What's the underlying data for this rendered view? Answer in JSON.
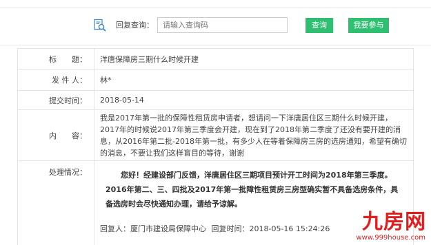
{
  "search": {
    "label": "回复查询：",
    "placeholder": "请输入查询码",
    "query_button": "查询",
    "join_button": "我要参与"
  },
  "detail": {
    "title_label": "标　　题：",
    "title_value": "洋唐保障房三期什么时候开建",
    "sender_label": "发 件 人：",
    "sender_value": "林*",
    "time_label": "提交时间：",
    "time_value": "2018-05-14",
    "content_label": "内　　容：",
    "content_value": "我是2017年第一批的保障性租赁房申请者，想请问一下洋唐居住区三期什么时候开建，2017年的时候说2017年第三季度会开建，现在到了2018年第二季度了还没有要开建的消息，从2016年第二批-2018年第一批，有多少人在等着保障房三房的选房通知，希望有确切的消息，不要让我们这样盲目的等待，谢谢",
    "reply_label": "处理情况：",
    "reply_body": "您好！经建设部门反馈，洋唐居住区三期项目预计开工时间为2018年第三季度。2016年第二、三、四批及2017年第一批障性租赁房三房型确实暂不具备选房条件，具备选房时会尽快通知办理，请给予谅解。",
    "replier": "回复人：厦门市建设局保障中心",
    "reply_time": "回复时间：2018-05-16 15:24:26"
  },
  "watermark": {
    "brand": "九房网",
    "site": "www.999house.com"
  },
  "colors": {
    "button_green": "#2fbf71",
    "border_gray": "#e3e3e3",
    "watermark_red": "#e01e1e"
  },
  "icons": {
    "search": "magnifier-document-icon"
  }
}
